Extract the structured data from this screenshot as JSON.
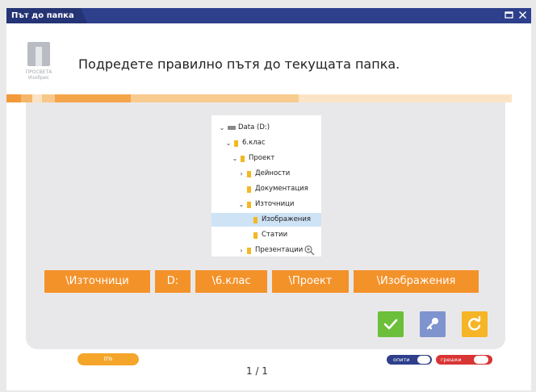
{
  "window": {
    "title": "Път до папка",
    "maximize_icon": "maximize-icon",
    "close_icon": "close-icon"
  },
  "logo": {
    "lines": [
      "ПРОСВЕТА",
      "Изобрис"
    ]
  },
  "instruction": "Подредете правилно пътя до текущата папка.",
  "tree": [
    {
      "label": "Data (D:)",
      "indent": 0,
      "chevron": "expanded",
      "icon": "drive-icon"
    },
    {
      "label": "6.клас",
      "indent": 1,
      "chevron": "expanded",
      "icon": "folder-icon"
    },
    {
      "label": "Проект",
      "indent": 2,
      "chevron": "expanded",
      "icon": "folder-icon"
    },
    {
      "label": "Дейности",
      "indent": 3,
      "chevron": "collapsed",
      "icon": "folder-icon"
    },
    {
      "label": "Документация",
      "indent": 3,
      "chevron": "none",
      "icon": "folder-icon"
    },
    {
      "label": "Източници",
      "indent": 3,
      "chevron": "expanded",
      "icon": "folder-icon"
    },
    {
      "label": "Изображения",
      "indent": 4,
      "chevron": "none",
      "icon": "folder-icon",
      "selected": true
    },
    {
      "label": "Статии",
      "indent": 4,
      "chevron": "none",
      "icon": "folder-icon"
    },
    {
      "label": "Презентации",
      "indent": 3,
      "chevron": "collapsed",
      "icon": "folder-icon"
    }
  ],
  "segments": [
    "\\Източници",
    "D:",
    "\\6.клас",
    "\\Проект",
    "\\Изображения"
  ],
  "actions": [
    {
      "name": "check-button",
      "color": "#6cbf3a",
      "icon": "check-icon"
    },
    {
      "name": "hint-button",
      "color": "#7f93cf",
      "icon": "key-icon"
    },
    {
      "name": "reset-button",
      "color": "#f6b526",
      "icon": "refresh-icon"
    }
  ],
  "progress": "0%",
  "counter": "1 / 1",
  "attempts_label": "опити",
  "errors_label": "грешки",
  "colors": {
    "title_bar": "#2e3f8c",
    "accent": "#f4922a"
  }
}
